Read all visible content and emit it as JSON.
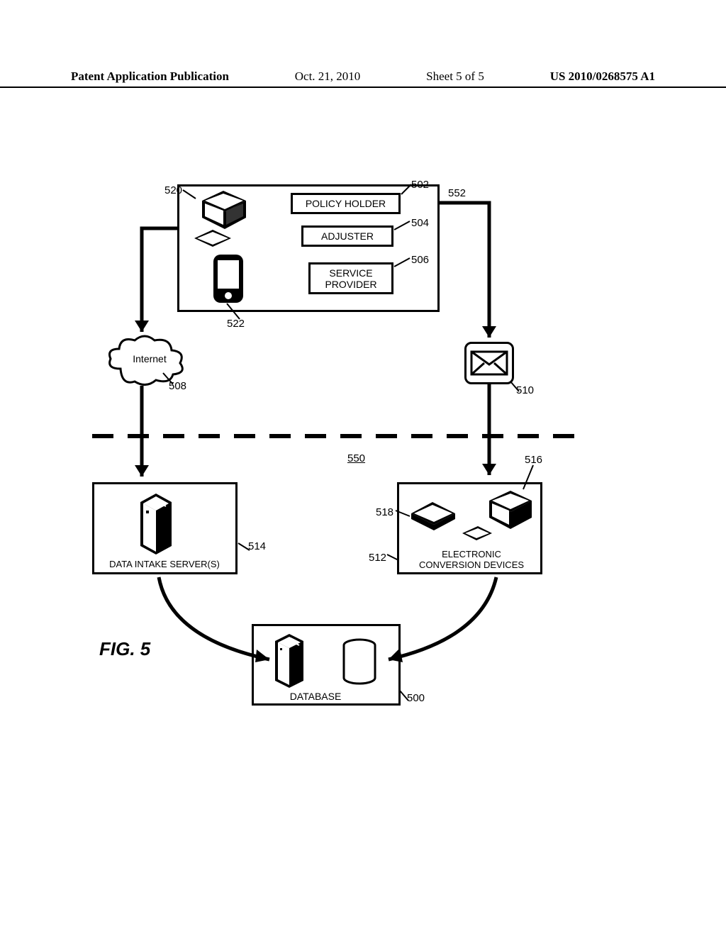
{
  "header": {
    "publication": "Patent Application Publication",
    "date": "Oct. 21, 2010",
    "sheet": "Sheet 5 of 5",
    "docnum": "US 2010/0268575 A1"
  },
  "figure_label": "FIG. 5",
  "top_block": {
    "policy_holder": "POLICY HOLDER",
    "adjuster": "ADJUSTER",
    "service_provider": "SERVICE\nPROVIDER"
  },
  "internet_label": "Internet",
  "server_block": "DATA INTAKE SERVER(S)",
  "conversion_block": "ELECTRONIC\nCONVERSION DEVICES",
  "database_block": "DATABASE",
  "ref": {
    "r500": "500",
    "r502": "502",
    "r504": "504",
    "r506": "506",
    "r508": "508",
    "r510": "510",
    "r512": "512",
    "r514": "514",
    "r516": "516",
    "r518": "518",
    "r520": "520",
    "r522": "522",
    "r550": "550",
    "r552": "552"
  }
}
